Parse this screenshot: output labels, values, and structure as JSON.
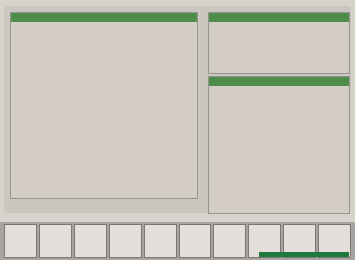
{
  "instructions_panel": {
    "title": "",
    "text": ""
  },
  "status_panel": {
    "title": "",
    "items": [
      {
        "name": "",
        "value": ""
      },
      {
        "name": "",
        "value": ""
      },
      {
        "name": "",
        "value": ""
      },
      {
        "name": "",
        "value": ""
      }
    ]
  },
  "notes_panel": {
    "title": "",
    "text": ""
  },
  "status_line": "",
  "function_keys": [
    "",
    "",
    "",
    "",
    "",
    "",
    "",
    "",
    "",
    ""
  ]
}
